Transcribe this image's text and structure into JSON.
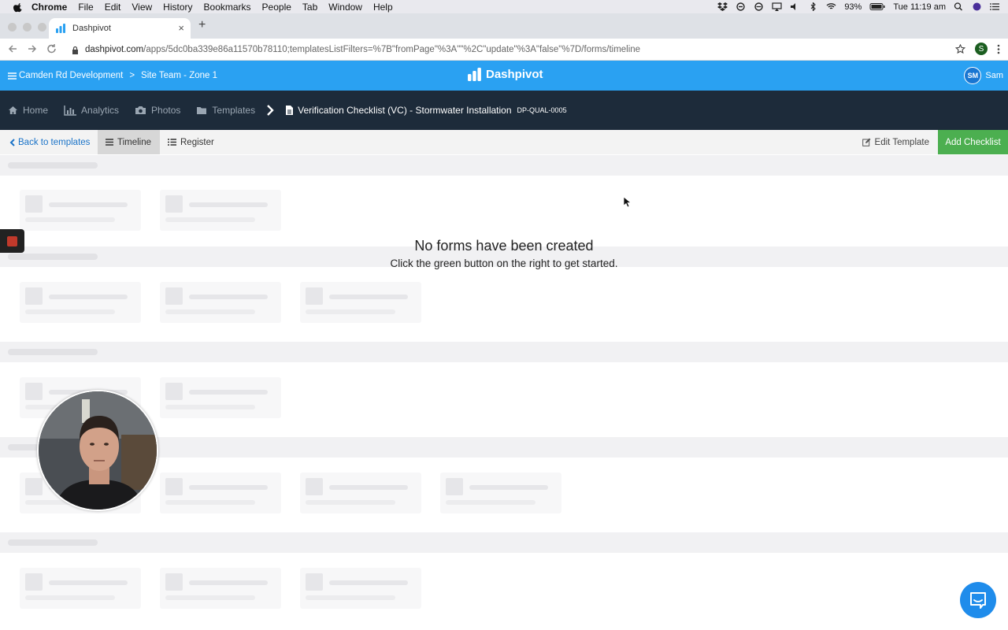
{
  "menubar": {
    "items": [
      "Chrome",
      "File",
      "Edit",
      "View",
      "History",
      "Bookmarks",
      "People",
      "Tab",
      "Window",
      "Help"
    ],
    "battery": "93%",
    "clock": "Tue 11:19 am"
  },
  "browser": {
    "tab_title": "Dashpivot",
    "tab_close": "×",
    "new_tab": "+",
    "url_host": "dashpivot.com",
    "url_path": "/apps/5dc0ba339e86a11570b78110;templatesListFilters=%7B\"fromPage\"%3A\"\"%2C\"update\"%3A\"false\"%7D/forms/timeline",
    "profile_initial": "S"
  },
  "appbar": {
    "breadcrumb_project": "Camden Rd Development",
    "breadcrumb_sep": ">",
    "breadcrumb_team": "Site Team - Zone 1",
    "brand": "Dashpivot",
    "avatar_initials": "SM",
    "user_name": "Sam"
  },
  "nav": {
    "home": "Home",
    "analytics": "Analytics",
    "photos": "Photos",
    "templates": "Templates",
    "template_name": "Verification Checklist (VC) - Stormwater Installation",
    "template_code": "DP-QUAL-0005"
  },
  "toolbar": {
    "back": "Back to templates",
    "timeline": "Timeline",
    "register": "Register",
    "edit_template": "Edit Template",
    "add_checklist": "Add Checklist"
  },
  "empty_state": {
    "title": "No forms have been created",
    "subtitle": "Click the green button on the right to get started."
  },
  "colors": {
    "appbar_blue": "#2aa1f2",
    "nav_dark": "#1d2b3a",
    "add_green": "#4caf50",
    "link_blue": "#1a73c8"
  }
}
